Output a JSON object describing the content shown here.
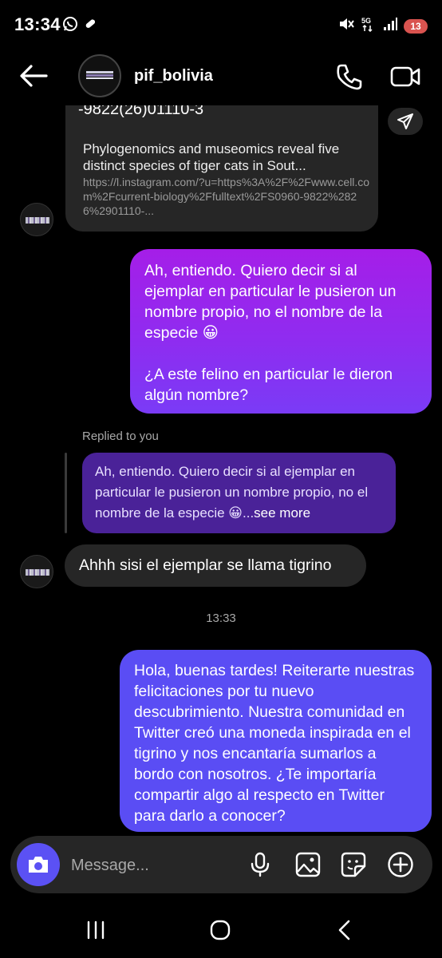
{
  "status_bar": {
    "time": "13:34",
    "battery_level": "13",
    "left_icons": [
      "whatsapp-icon",
      "notification-icon"
    ],
    "right_icons": [
      "mute-icon",
      "5g-icon",
      "signal-icon"
    ]
  },
  "header": {
    "username": "pif_bolivia",
    "icons": [
      "back-arrow-icon",
      "phone-icon",
      "video-camera-icon"
    ]
  },
  "thread": {
    "link_card": {
      "code": "-9822(26)01110-3",
      "title": "Phylogenomics and museomics reveal five distinct species of tiger cats in Sout...",
      "url": "https://l.instagram.com/?u=https%3A%2F%2Fwww.cell.com%2Fcurrent-biology%2Ffulltext%2FS0960-9822%2826%2901110-..."
    },
    "outgoing_1": {
      "paragraph_1": "Ah, entiendo. Quiero decir si al ejemplar en particular le pusieron un nombre propio, no el nombre de la especie 😀",
      "paragraph_2": "¿A este felino en particular le dieron algún nombre?"
    },
    "replied_label": "Replied to you",
    "reply_quote": {
      "text": "Ah, entiendo. Quiero decir si al ejemplar en particular le pusieron un nombre propio, no el nombre de la especie 😀...",
      "more": "see more"
    },
    "incoming": "Ahhh sisi el ejemplar se llama tigrino",
    "timestamp": "13:33",
    "outgoing_2": "Hola, buenas tardes! Reiterarte nuestras felicitaciones por tu nuevo descubrimiento. Nuestra comunidad en Twitter creó una moneda inspirada en el tigrino y nos encantaría sumarlos a bordo con nosotros. ¿Te importaría compartir algo al respecto en Twitter para darlo a conocer?"
  },
  "composer": {
    "placeholder": "Message...",
    "icons": [
      "camera-icon",
      "microphone-icon",
      "gallery-icon",
      "sticker-icon",
      "add-icon"
    ]
  },
  "colors": {
    "background": "#000000",
    "incoming_bubble": "#262626",
    "outgoing_gradient_top": "#a51ee8",
    "outgoing_gradient_bottom": "#7a3bf6",
    "outgoing_blue": "#5a4df4",
    "reply_quote": "#4a2298",
    "camera_button": "#5b51f4"
  }
}
